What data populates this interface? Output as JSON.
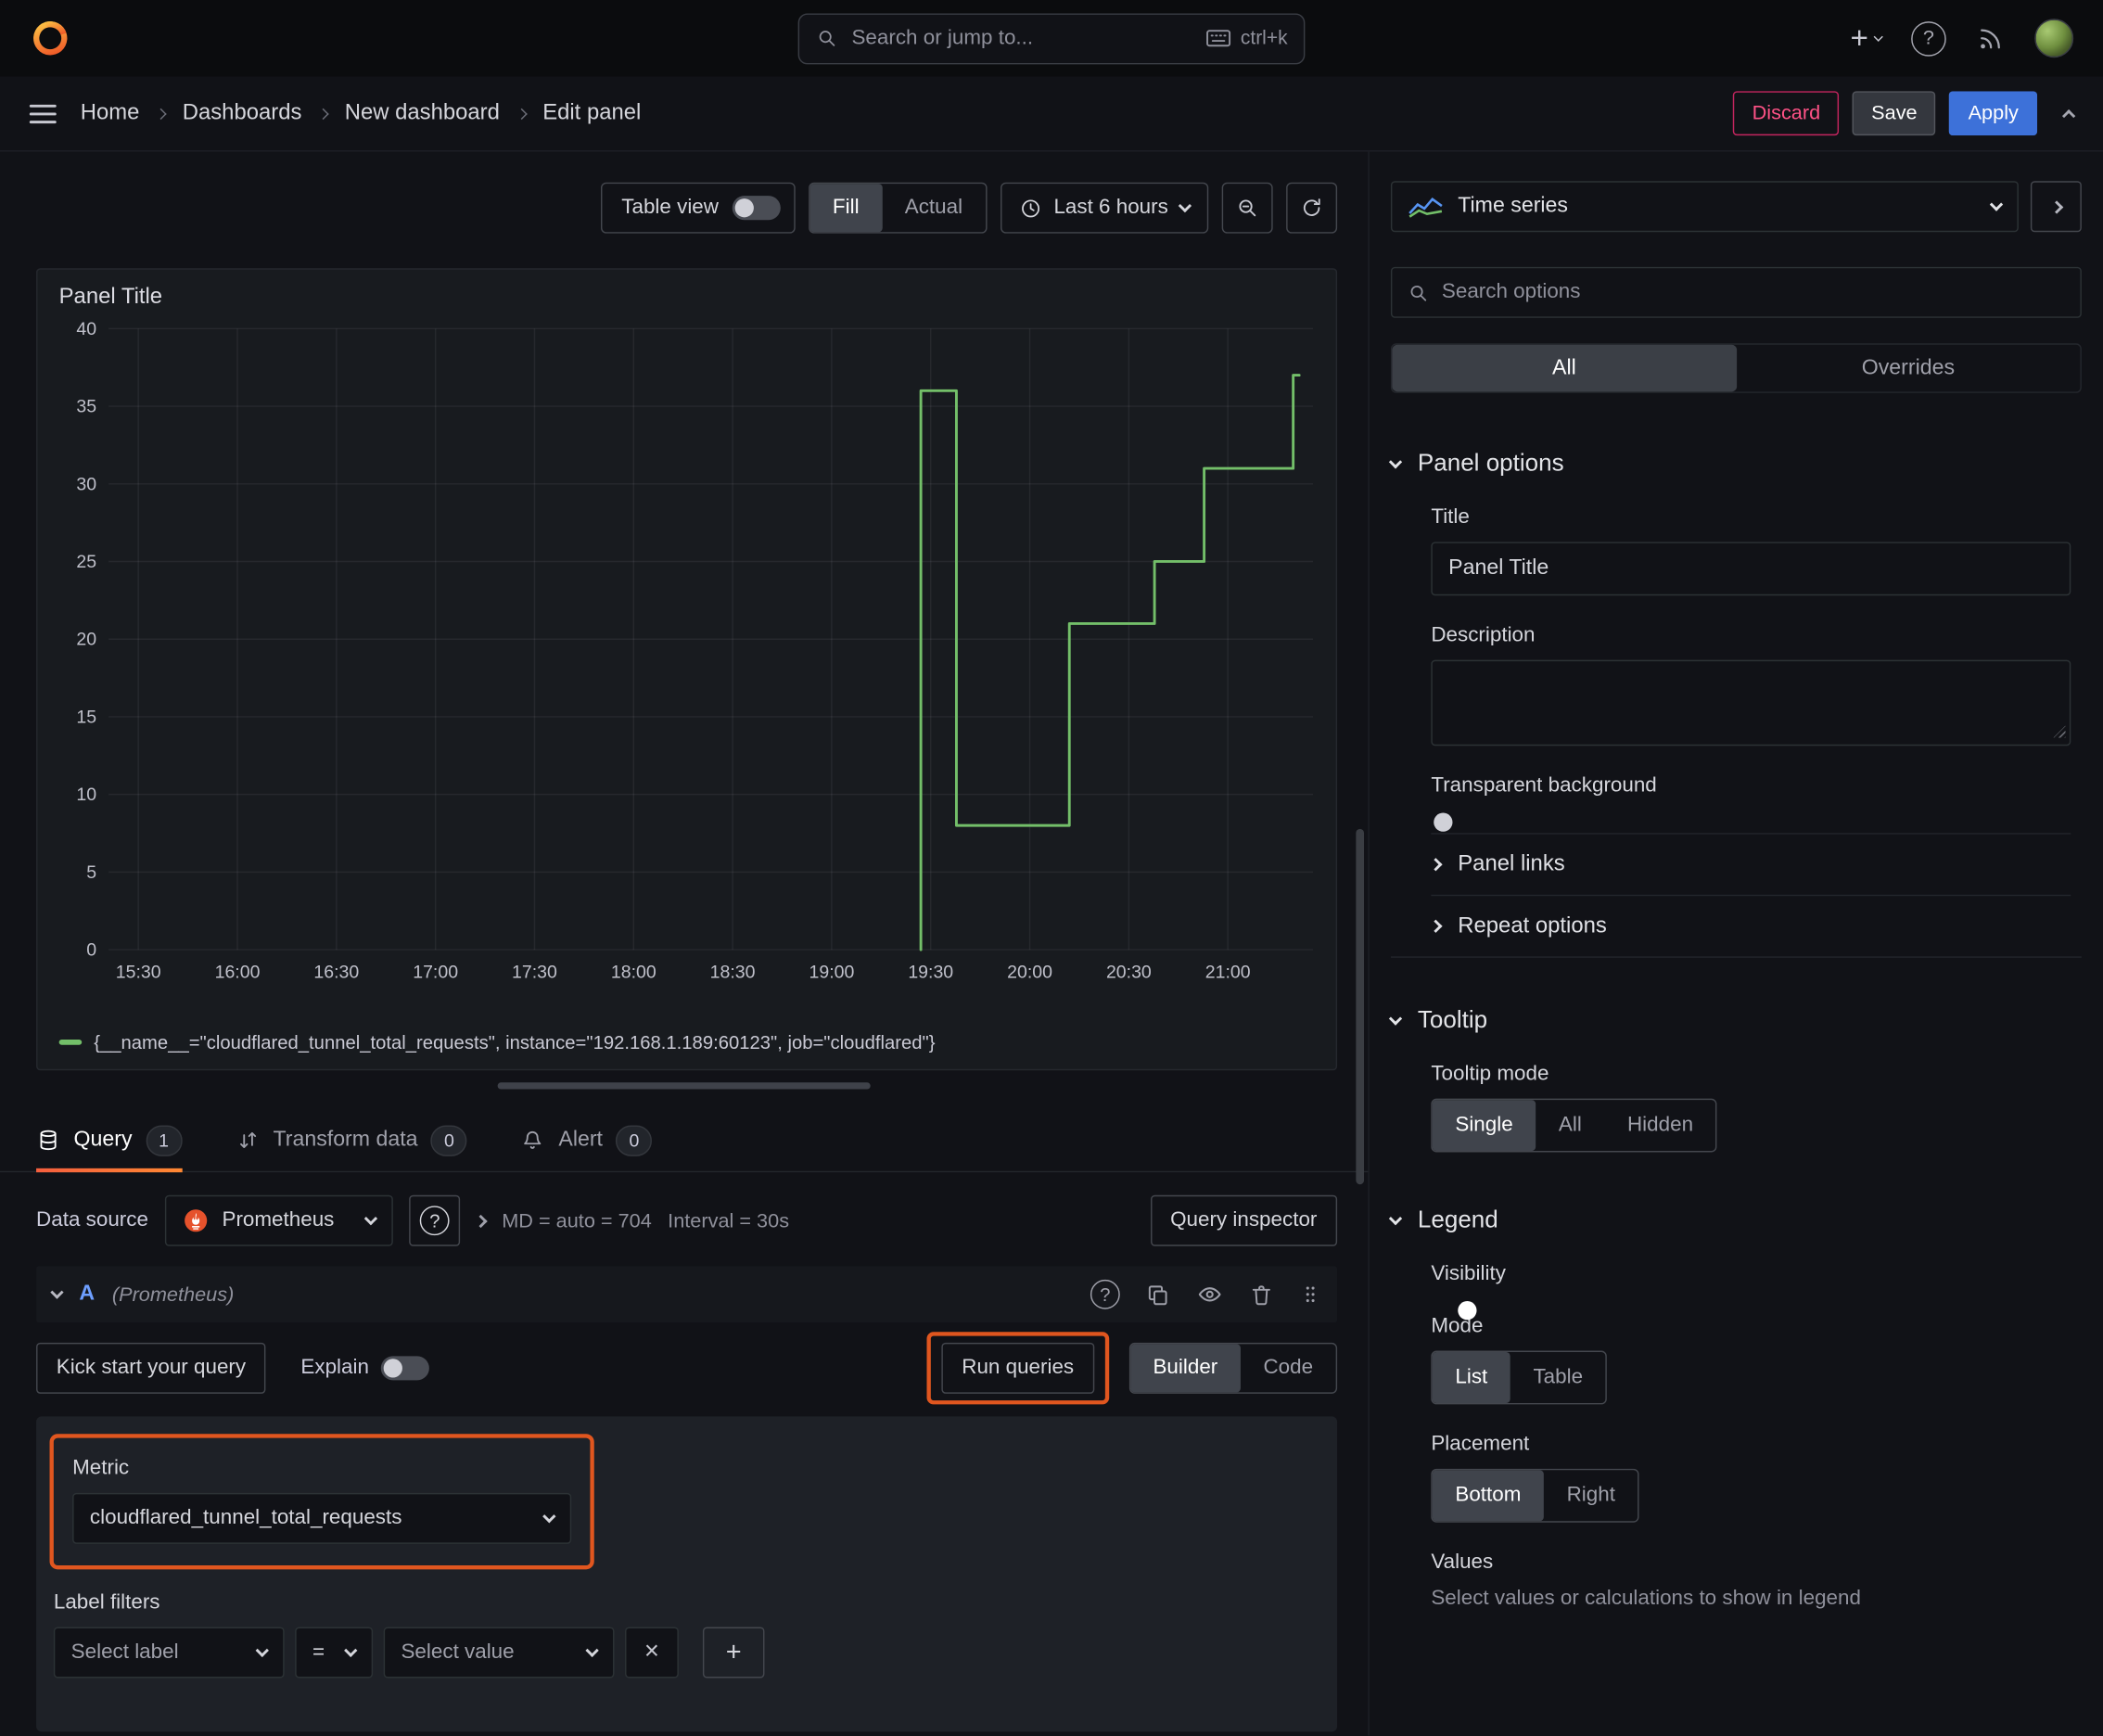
{
  "colors": {
    "accent_blue": "#3d71d9",
    "series_green": "#73bf69",
    "highlight_orange": "#e0561f",
    "brand_orange": "#ff780a",
    "discard_pink": "#ff5286"
  },
  "topnav": {
    "search_placeholder": "Search or jump to...",
    "shortcut": "ctrl+k"
  },
  "breadcrumb": {
    "items": [
      "Home",
      "Dashboards",
      "New dashboard",
      "Edit panel"
    ]
  },
  "header_actions": {
    "discard": "Discard",
    "save": "Save",
    "apply": "Apply"
  },
  "toolbar": {
    "table_view": "Table view",
    "fill": "Fill",
    "actual": "Actual",
    "time_range": "Last 6 hours"
  },
  "panel": {
    "title": "Panel Title",
    "legend_label": "{__name__=\"cloudflared_tunnel_total_requests\", instance=\"192.168.1.189:60123\", job=\"cloudflared\"}"
  },
  "chart_data": {
    "type": "line",
    "title": "Panel Title",
    "grid": true,
    "legend_position": "bottom",
    "xlim_hours": [
      15.35,
      21.43
    ],
    "ylim": [
      0,
      40
    ],
    "x_ticks": [
      "15:30",
      "16:00",
      "16:30",
      "17:00",
      "17:30",
      "18:00",
      "18:30",
      "19:00",
      "19:30",
      "20:00",
      "20:30",
      "21:00"
    ],
    "x_tick_hours": [
      15.5,
      16,
      16.5,
      17,
      17.5,
      18,
      18.5,
      19,
      19.5,
      20,
      20.5,
      21
    ],
    "y_ticks": [
      0,
      5,
      10,
      15,
      20,
      25,
      30,
      35,
      40
    ],
    "series": [
      {
        "name": "{__name__=\"cloudflared_tunnel_total_requests\", instance=\"192.168.1.189:60123\", job=\"cloudflared\"}",
        "color": "#73bf69",
        "step": true,
        "points": [
          [
            19.45,
            0
          ],
          [
            19.45,
            36
          ],
          [
            19.63,
            36
          ],
          [
            19.63,
            8
          ],
          [
            20.2,
            8
          ],
          [
            20.2,
            21
          ],
          [
            20.63,
            21
          ],
          [
            20.63,
            25
          ],
          [
            20.88,
            25
          ],
          [
            20.88,
            31
          ],
          [
            21.33,
            31
          ],
          [
            21.33,
            37
          ],
          [
            21.36,
            37
          ]
        ]
      }
    ]
  },
  "tabs": [
    {
      "label": "Query",
      "count": "1"
    },
    {
      "label": "Transform data",
      "count": "0"
    },
    {
      "label": "Alert",
      "count": "0"
    }
  ],
  "query_editor": {
    "datasource_label": "Data source",
    "datasource_name": "Prometheus",
    "stats_md": "MD = auto = 704",
    "stats_interval": "Interval = 30s",
    "query_inspector": "Query inspector",
    "ref_id": "A",
    "ref_datasource": "(Prometheus)",
    "kick_start": "Kick start your query",
    "explain": "Explain",
    "run_queries": "Run queries",
    "builder": "Builder",
    "code": "Code",
    "metric_label": "Metric",
    "metric_value": "cloudflared_tunnel_total_requests",
    "label_filters": "Label filters",
    "select_label": "Select label",
    "operator": "=",
    "select_value": "Select value"
  },
  "options_pane": {
    "visualization": "Time series",
    "search_placeholder": "Search options",
    "tab_all": "All",
    "tab_overrides": "Overrides",
    "panel_options": {
      "heading": "Panel options",
      "title_label": "Title",
      "title_value": "Panel Title",
      "description_label": "Description",
      "description_value": "",
      "transparent_label": "Transparent background",
      "panel_links": "Panel links",
      "repeat_options": "Repeat options"
    },
    "tooltip": {
      "heading": "Tooltip",
      "mode_label": "Tooltip mode",
      "modes": [
        "Single",
        "All",
        "Hidden"
      ],
      "active_mode": "Single"
    },
    "legend": {
      "heading": "Legend",
      "visibility_label": "Visibility",
      "mode_label": "Mode",
      "modes": [
        "List",
        "Table"
      ],
      "active_mode": "List",
      "placement_label": "Placement",
      "placements": [
        "Bottom",
        "Right"
      ],
      "active_placement": "Bottom",
      "values_label": "Values",
      "values_help": "Select values or calculations to show in legend"
    }
  }
}
